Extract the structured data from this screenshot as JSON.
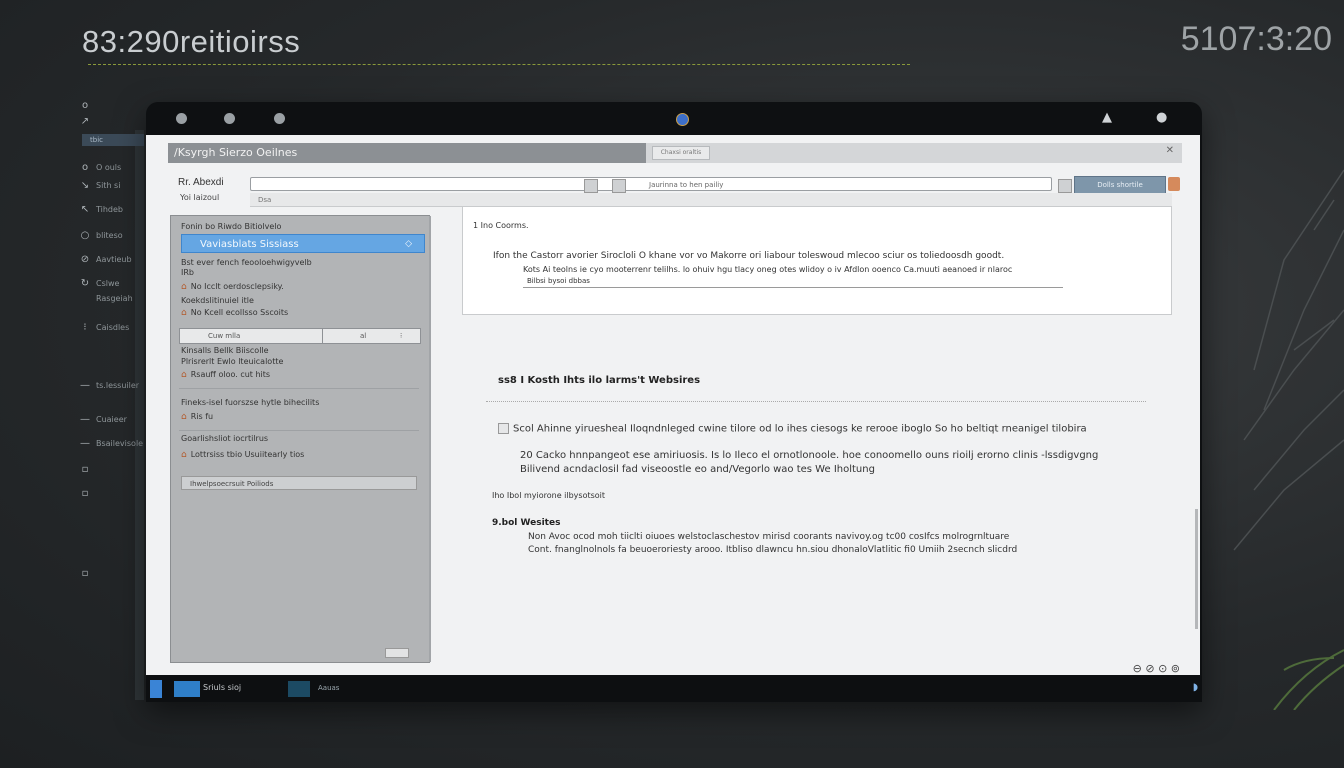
{
  "desktop": {
    "title": "83:290reitioirss",
    "clock": "5107:3:20"
  },
  "dock": {
    "tab_label": "tbic",
    "items": [
      {
        "icon": "o",
        "label": "O ouls"
      },
      {
        "icon": "↘",
        "label": "Sith si"
      },
      {
        "icon": "↖",
        "label": "Tihdeb"
      },
      {
        "icon": "○",
        "label": "bliteso"
      },
      {
        "icon": "⊘",
        "label": "Aavtieub"
      },
      {
        "icon": "↻",
        "label": "Cslwe"
      },
      {
        "icon": "",
        "label": "Rasgeiah"
      },
      {
        "icon": "⁝",
        "label": "Caisdles"
      },
      {
        "icon": "—",
        "label": "ts.lessuiler"
      },
      {
        "icon": "—",
        "label": "Cuaieer"
      },
      {
        "icon": "—",
        "label": "Bsailevisole"
      }
    ]
  },
  "app": {
    "header_title": "/Ksyrgh  Sierzo  Oeilnes",
    "header_pill": "Chaxsi oraltis",
    "address_text": "Jaurinna to hen pailiy",
    "action_button": "Dolls shortile",
    "tab_text": "Dsa",
    "side_label": "Rr. Abexdi",
    "side_sub": "Yoi  laizoul"
  },
  "sidebar": {
    "selected": "Vaviasblats   Sissiass",
    "items": [
      {
        "label": "Fonin bo Riwdo Bitiolvelo",
        "icon": ""
      },
      {
        "label": "Bst ever fench  feooloehwigyvelb",
        "icon": ""
      },
      {
        "label": "IRb",
        "icon": ""
      },
      {
        "label": "No Icclt oerdosclepsiky.",
        "icon": "⌂"
      },
      {
        "label": "Koekdslitinuiel  itle",
        "icon": ""
      },
      {
        "label": "No Kcell ecollsso Sscoits",
        "icon": "⌂"
      },
      {
        "label": "Kinsalls Bellk Biiscolle",
        "icon": ""
      },
      {
        "label": "Plrisrerlt  Ewlo lteuicalotte",
        "icon": ""
      },
      {
        "label": "Rsauff oloo. cut hits",
        "icon": "⌂"
      },
      {
        "label": "Fineks-isel  fuorszse  hytle bihecilits",
        "icon": ""
      },
      {
        "label": "Ris  fu",
        "icon": "⌂"
      },
      {
        "label": "Goarlishsliot iocrtilrus",
        "icon": ""
      },
      {
        "label": "Lottrsiss tbio Usuiitearly tios",
        "icon": "⌂"
      }
    ],
    "toolbar_left": "Cuw    mlla",
    "toolbar_right": "al",
    "bar2_text": "Ihwelpsoecrsuit      Poiliods"
  },
  "content": {
    "section_title": "1 Ino  Coorms.",
    "lines": [
      "Ifon the Castorr avorier Sirocloli O khane vor vo Makorre ori liabour toleswoud mlecoo sciur os toliedoosdh goodt.",
      "Kots Ai teolns ie cyo mooterrenr telilhs. lo ohuiv hgu tlacy oneg otes wlidoy o iv Afdlon ooenco Ca.muuti aeanoed ir nlaroc",
      "Bilbsi bysoi dbbas"
    ]
  },
  "section2": {
    "heading": "ss8 I Kosth Ihts ilo larms't Websires",
    "rows": [
      "Scol Ahinne yiruesheal  Iloqndnleged cwine tilore od lo ihes ciesogs  ke  rerooe iboglo So ho beltiqt rneanigel  tilobira",
      "20 Cacko hnnpangeot  ese amiriuosis. Is lo Ileco el ornotlonoole. hoe conoomello ouns rioilj erorno clinis -lssdigvgng",
      "Bilivend  acndaclosil  fad viseoostle eo and/Vegorlo wao tes  We Iholtung"
    ],
    "note": "Iho Ibol  myiorone ilbysotsoit",
    "subheading": "9.bol Wesites",
    "para": [
      "Non Avoc ocod moh tiiclti oiuoes  welstoclaschestov  mirisd coorants navivoy.og  tc00  cosIfcs molrogrnltuare",
      "Cont. fnanglnolnols fa beuoeroriesty arooo. Itbliso dlawncu hn.siou dhonaloVlatlitic fi0 Umiih  2secnch slicdrd"
    ]
  },
  "taskbar": {
    "app1_label": "Sriuls sioj",
    "app2_label": "Aauas"
  },
  "colors": {
    "accent": "#65a6e3",
    "screen_bg": "#f1f2f3",
    "desktop_bg": "#26292b"
  }
}
